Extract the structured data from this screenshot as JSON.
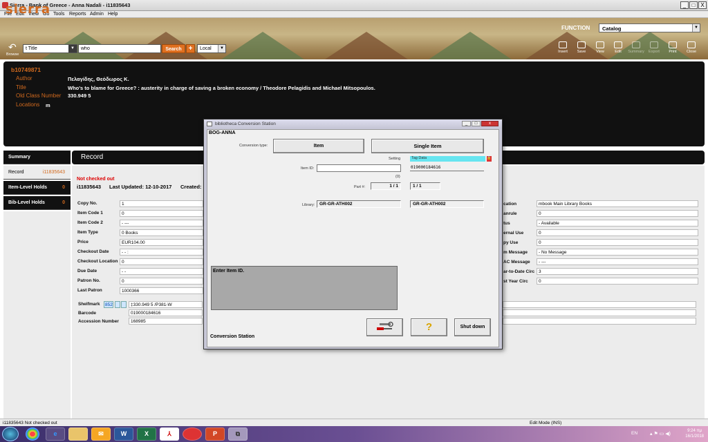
{
  "window": {
    "title": "Sierra - Bank of Greece - Anna Nadali - i11835643",
    "minimize": "_",
    "maximize": "□",
    "close": "X"
  },
  "menu": [
    "File",
    "Edit",
    "View",
    "Go",
    "Tools",
    "Reports",
    "Admin",
    "Help"
  ],
  "banner": {
    "logo": "sierra",
    "function_label": "FUNCTION",
    "function_value": "Catalog",
    "browse_label": "Browse",
    "index_value": "t Title",
    "search_value": "who",
    "search_button": "Search",
    "plus_button": "+",
    "scope_value": "Local",
    "tools": [
      "Insert",
      "Save",
      "View",
      "Edit",
      "Summary",
      "Export",
      "Print",
      "Close"
    ]
  },
  "bib": {
    "number": "b10749871",
    "author_label": "Author",
    "author": "Πελαγίδης, Θεόδωρος Κ.",
    "title_label": "Title",
    "title": "Who's to blame for Greece? : austerity in charge of saving a broken economy / Theodore Pelagidis and Michael Mitsopoulos.",
    "oldclass_label": "Old Class Number",
    "oldclass": "330.949 5",
    "locations_label": "Locations",
    "locations": "m"
  },
  "nav": {
    "summary": "Summary",
    "record": "Record",
    "record_num": "i11835643",
    "item_holds": "Item-Level Holds",
    "item_holds_n": "0",
    "bib_holds": "Bib-Level Holds",
    "bib_holds_n": "0"
  },
  "record": {
    "header": "Record",
    "status": "Not checked out",
    "item_num": "i11835643",
    "updated": "Last Updated: 12-10-2017",
    "created": "Created:",
    "left_fields": [
      {
        "label": "Copy No.",
        "value": "1"
      },
      {
        "label": "Item Code 1",
        "value": "0"
      },
      {
        "label": "Item Code 2",
        "value": "- ---"
      },
      {
        "label": "Item Type",
        "value": "0  Books"
      },
      {
        "label": "Price",
        "value": "EUR104.00"
      },
      {
        "label": "Checkout Date",
        "value": "- -      :"
      },
      {
        "label": "Checkout Location",
        "value": "0"
      },
      {
        "label": "Due Date",
        "value": "- -"
      },
      {
        "label": "Patron No.",
        "value": "0"
      },
      {
        "label": "Last Patron",
        "value": "1000366"
      }
    ],
    "right_fields": [
      {
        "label": "cation",
        "value": "mbook  Main Library Books"
      },
      {
        "label": "anrule",
        "value": "0"
      },
      {
        "label": "tus",
        "value": "-  Available"
      },
      {
        "label": "ernal Use",
        "value": "0"
      },
      {
        "label": "py Use",
        "value": "0"
      },
      {
        "label": "m Message",
        "value": "-  No Message"
      },
      {
        "label": "AC Message",
        "value": "- ---"
      },
      {
        "label": "ar-to-Date Circ",
        "value": "3"
      },
      {
        "label": "st Year Circ",
        "value": "0"
      }
    ],
    "shelfmark_label": "Shelfmark",
    "shelfmark_tag": "852",
    "shelfmark_value": "‡330.949 5 /P381-W",
    "barcode_label": "Barcode",
    "barcode_value": "019000184616",
    "accession_label": "Accession Number",
    "accession_value": "168985"
  },
  "dialog": {
    "title": "bibliotheca Conversion Station",
    "user": "BOG-ANNA",
    "conv_type_label": "Conversion type:",
    "btn_item": "Item",
    "btn_single": "Single Item",
    "setting_label": "Setting",
    "tag_data": "Tag Data",
    "item_id_label": "Item ID:",
    "item_id_value": "",
    "tag_item_id": "019000184616",
    "counter": "(0)",
    "part_label": "Part #:",
    "part_value": "1 / 1",
    "tag_part": "1 / 1",
    "library_label": "Library:",
    "library_value": "GR-GR-ATH002",
    "tag_library": "GR-GR-ATH002",
    "message": "Enter Item ID.",
    "help_btn": "?",
    "shutdown_btn": "Shut down",
    "footer": "Conversion Station"
  },
  "statusbar": {
    "left": "i11835643  Not checked out",
    "right": "Edit Mode (INS)"
  },
  "taskbar": {
    "lang": "EN",
    "time": "9:24 πμ",
    "date": "16/1/2018"
  },
  "colors": {
    "accent": "#d26a1e",
    "dark_panel": "#111111",
    "search_orange": "#e07020",
    "tag_cyan": "#66e5f0"
  }
}
